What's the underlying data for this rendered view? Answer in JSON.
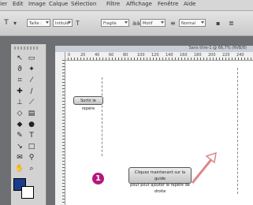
{
  "menubar": {
    "items": [
      "ier",
      "Edit",
      "Image",
      "Calque",
      "Sélection",
      "Filtre",
      "Affichage",
      "Fenêtre",
      "Aide"
    ]
  },
  "options": {
    "tool_preset_icon": "move-tool",
    "field1": "Taille : ",
    "field2": "Intitulé",
    "field3": "Fragile",
    "field4": "Motif",
    "field5": "Normal"
  },
  "document": {
    "title": "Sans titre-1 @ 66,7% (RVB/8)",
    "ruler_ticks": [
      "0",
      "20",
      "40",
      "60",
      "80",
      "100",
      "120",
      "140",
      "160",
      "180",
      "200",
      "220",
      "240"
    ]
  },
  "annotations": {
    "callout1": "Sortir le repère",
    "callout2_line1": "Cliquez maintenant sur la guide",
    "callout2_line2": "pour pour ajouter le repère de droite",
    "badge": "1"
  },
  "colors": {
    "badge": "#b5177e",
    "foreground": "#1a3d8a",
    "background": "#ffffff"
  }
}
